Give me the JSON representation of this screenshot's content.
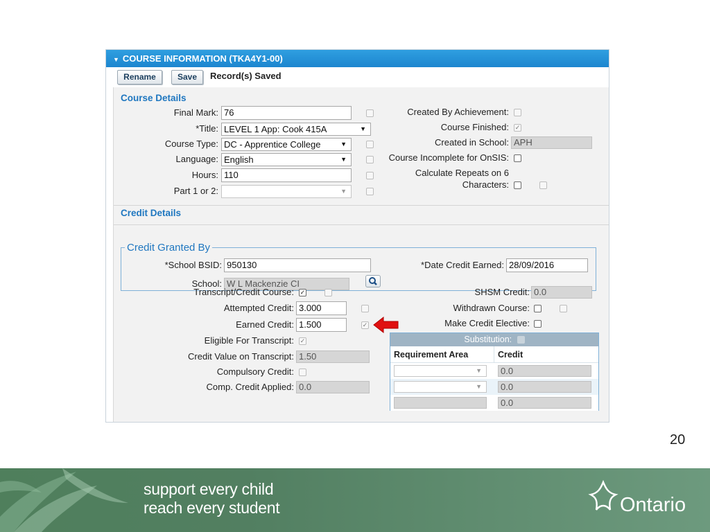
{
  "window": {
    "title": "COURSE INFORMATION (TKA4Y1-00)",
    "toolbar": {
      "rename": "Rename",
      "save": "Save",
      "status": "Record(s) Saved"
    }
  },
  "course_details": {
    "title": "Course Details",
    "final_mark": {
      "label": "Final Mark:",
      "value": "76"
    },
    "course_title": {
      "label": "*Title:",
      "value": "LEVEL 1 App: Cook 415A"
    },
    "course_type": {
      "label": "Course Type:",
      "value": "DC - Apprentice College"
    },
    "language": {
      "label": "Language:",
      "value": "English"
    },
    "hours": {
      "label": "Hours:",
      "value": "110"
    },
    "part": {
      "label": "Part 1 or 2:",
      "value": ""
    },
    "created_by_achievement": {
      "label": "Created By Achievement:",
      "checked": false
    },
    "course_finished": {
      "label": "Course Finished:",
      "checked": true
    },
    "created_in_school": {
      "label": "Created in School:",
      "value": "APH"
    },
    "course_incomplete": {
      "label": "Course Incomplete for OnSIS:",
      "checked": false
    },
    "calc_repeats_line1": "Calculate Repeats on 6",
    "calc_repeats_line2": "Characters:"
  },
  "credit_details": {
    "title": "Credit Details",
    "granted_by": {
      "legend": "Credit Granted By",
      "school_bsid": {
        "label": "*School BSID:",
        "value": "950130"
      },
      "date_earned": {
        "label": "*Date Credit Earned:",
        "value": "28/09/2016"
      },
      "school": {
        "label": "School:",
        "value": "W L Mackenzie CI"
      }
    },
    "transcript_course": {
      "label": "Transcript/Credit Course:",
      "checked": true
    },
    "attempted": {
      "label": "Attempted Credit:",
      "value": "3.000"
    },
    "earned": {
      "label": "Earned Credit:",
      "value": "1.500"
    },
    "eligible": {
      "label": "Eligible For Transcript:",
      "checked": true
    },
    "credit_value": {
      "label": "Credit Value on Transcript:",
      "value": "1.50"
    },
    "compulsory": {
      "label": "Compulsory Credit:",
      "checked": false
    },
    "comp_applied": {
      "label": "Comp. Credit Applied:",
      "value": "0.0"
    },
    "shsm": {
      "label": "SHSM Credit:",
      "value": "0.0"
    },
    "withdrawn": {
      "label": "Withdrawn Course:",
      "checked": false
    },
    "make_elective": {
      "label": "Make Credit Elective:",
      "checked": false
    },
    "substitution": {
      "label": "Substitution:",
      "columns": [
        "Requirement Area",
        "Credit"
      ],
      "rows": [
        {
          "area": "",
          "credit": "0.0"
        },
        {
          "area": "",
          "credit": "0.0"
        },
        {
          "area": "",
          "credit": "0.0"
        }
      ]
    }
  },
  "slide": {
    "number": "20",
    "tagline_line1": "support every child",
    "tagline_line2": "reach every student",
    "brand": "Ontario"
  },
  "colors": {
    "accent": "#1f77c0",
    "title_bar": "#2f9fe0",
    "banner": "#527f61",
    "arrow": "#e01010"
  }
}
